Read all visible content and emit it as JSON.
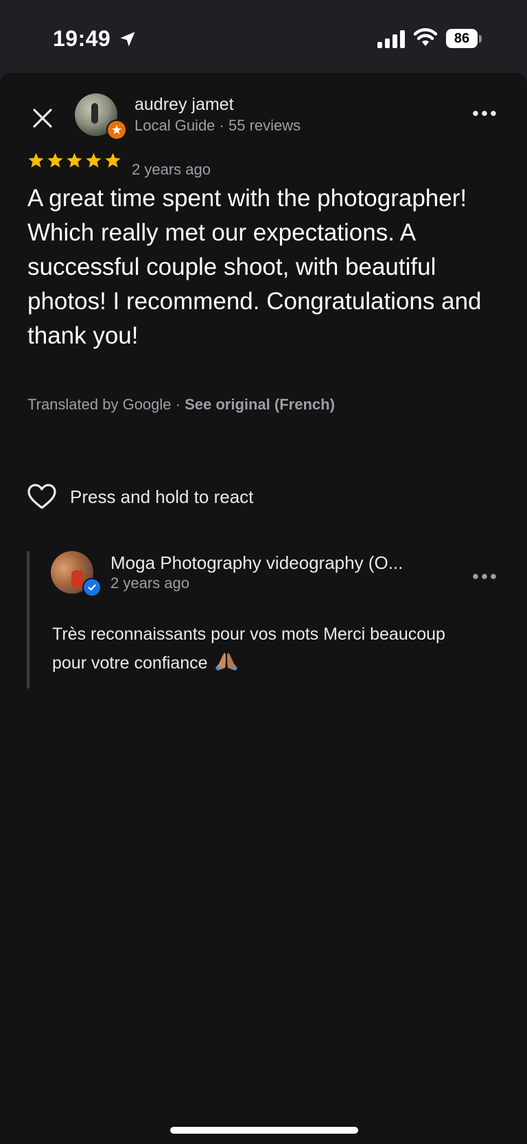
{
  "status_bar": {
    "time": "19:49",
    "battery": "86",
    "icons": [
      "location-arrow-icon",
      "cellular-signal-icon",
      "wifi-icon",
      "battery-icon"
    ]
  },
  "review": {
    "reviewer_name": "audrey jamet",
    "reviewer_meta": "Local Guide · 55 reviews",
    "rating": 5,
    "max_rating": 5,
    "date": "2 years ago",
    "text": "A great time spent with the photographer! Which really met our expectations. A successful couple shoot, with beautiful photos! I recommend. Congratulations and thank you!",
    "translated_by": "Translated by Google · ",
    "see_original": "See original (French)",
    "react_label": "Press and hold to react"
  },
  "owner_reply": {
    "name": "Moga Photography videography (O...",
    "date": "2 years ago",
    "text": "Très reconnaissants pour vos mots Merci beaucoup pour votre confiance"
  },
  "colors": {
    "background": "#131313",
    "star": "#fbbc04",
    "local_guide_badge": "#e8710a",
    "verified_badge": "#1a73e8",
    "secondary_text": "#9aa0a6"
  }
}
